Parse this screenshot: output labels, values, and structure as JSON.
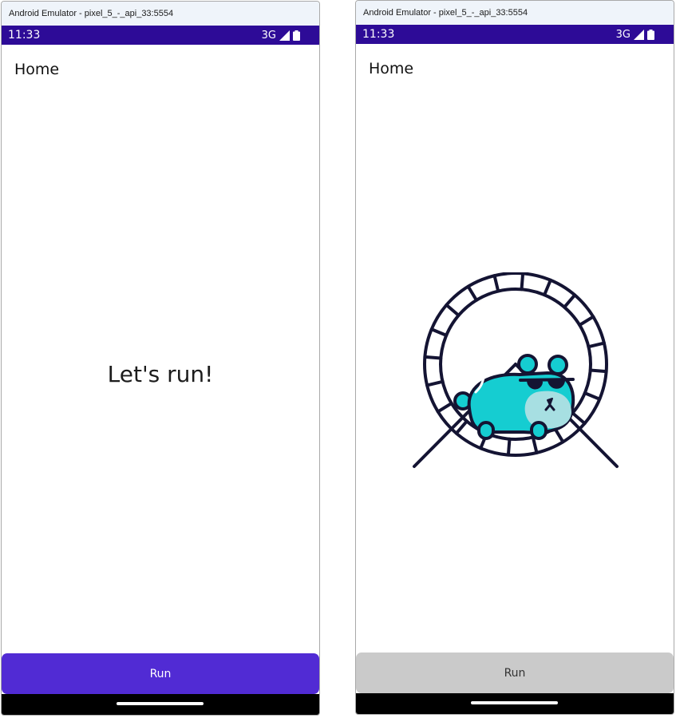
{
  "windows": [
    {
      "title": "Android Emulator - pixel_5_-_api_33:5554",
      "status": {
        "time": "11:33",
        "network": "3G"
      },
      "page_title": "Home",
      "center_text": "Let's run!",
      "button": {
        "label": "Run",
        "state": "enabled",
        "color": "#512bd4"
      }
    },
    {
      "title": "Android Emulator - pixel_5_-_api_33:5554",
      "status": {
        "time": "11:33",
        "network": "3G"
      },
      "page_title": "Home",
      "illustration": "hamster-wheel",
      "button": {
        "label": "Run",
        "state": "disabled",
        "color": "#cacaca"
      }
    }
  ],
  "colors": {
    "status_bar": "#2d0b97",
    "accent": "#512bd4",
    "hamster_body": "#15cdd1",
    "hamster_belly": "#a7dfe2",
    "wheel_outline": "#141433"
  }
}
